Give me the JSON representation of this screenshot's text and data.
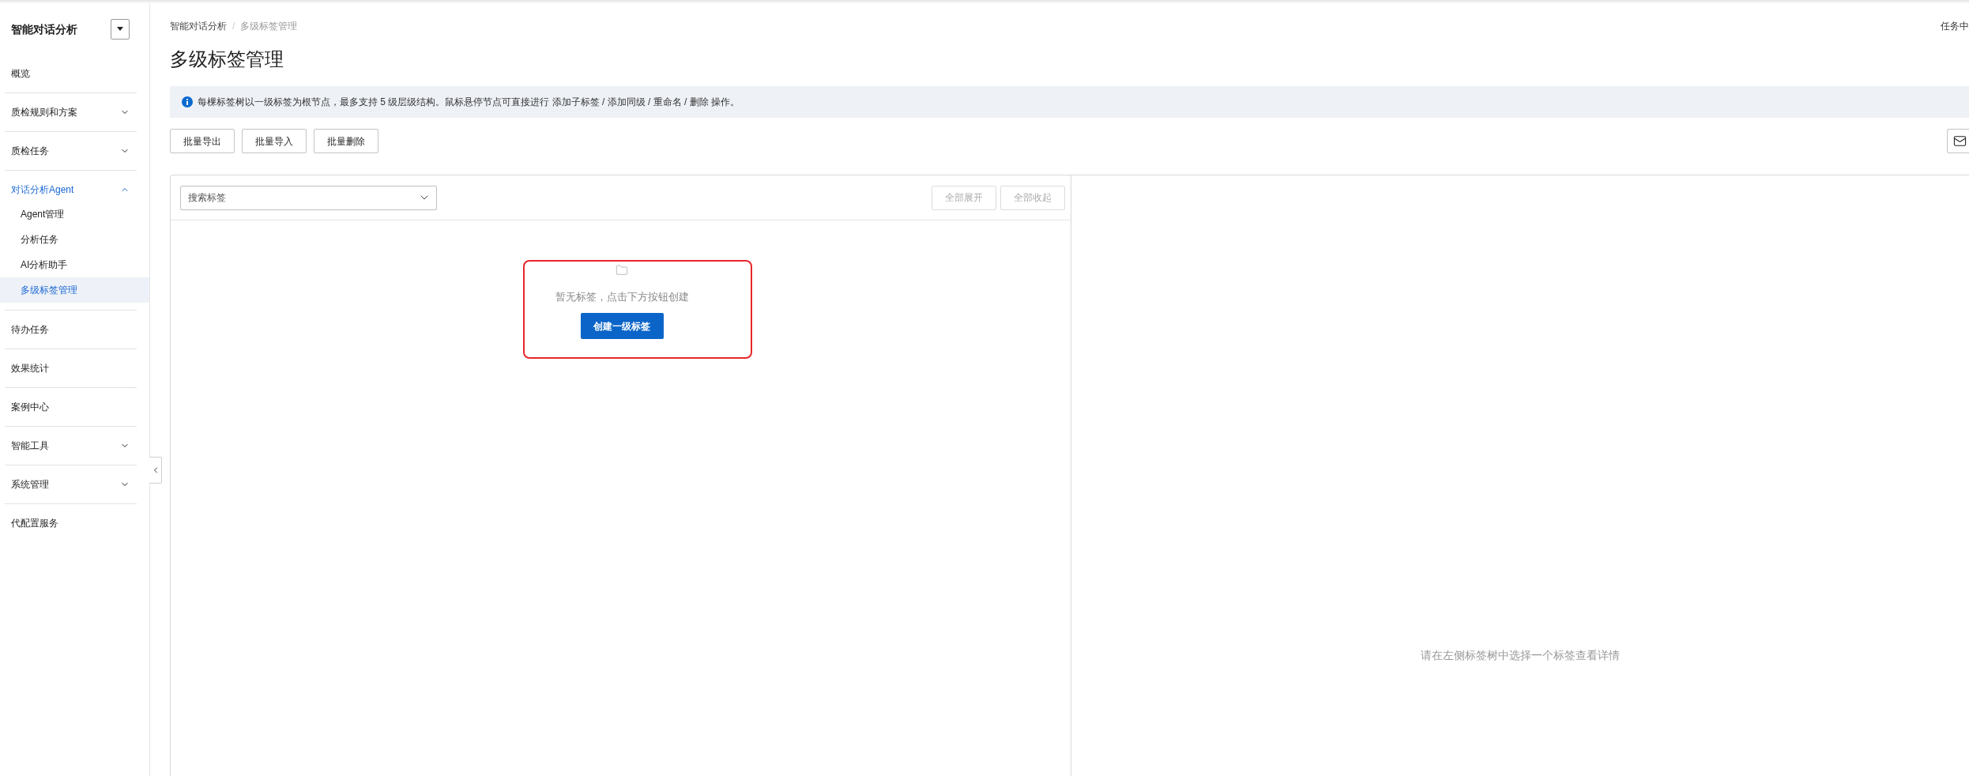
{
  "sidebar": {
    "title": "智能对话分析",
    "items": [
      {
        "label": "概览",
        "kind": "link",
        "selected": false
      },
      {
        "label": "质检规则和方案",
        "kind": "group",
        "selected": false,
        "expanded": false
      },
      {
        "label": "质检任务",
        "kind": "group",
        "selected": false,
        "expanded": false
      },
      {
        "label": "对话分析Agent",
        "kind": "group",
        "selected": true,
        "expanded": true,
        "children": [
          {
            "label": "Agent管理",
            "selected": false
          },
          {
            "label": "分析任务",
            "selected": false
          },
          {
            "label": "AI分析助手",
            "selected": false
          },
          {
            "label": "多级标签管理",
            "selected": true
          }
        ]
      },
      {
        "label": "待办任务",
        "kind": "link",
        "selected": false
      },
      {
        "label": "效果统计",
        "kind": "link",
        "selected": false
      },
      {
        "label": "案例中心",
        "kind": "link",
        "selected": false
      },
      {
        "label": "智能工具",
        "kind": "group",
        "selected": false,
        "expanded": false
      },
      {
        "label": "系统管理",
        "kind": "group",
        "selected": false,
        "expanded": false
      },
      {
        "label": "代配置服务",
        "kind": "link",
        "selected": false
      }
    ]
  },
  "breadcrumb": {
    "items": [
      "智能对话分析",
      "多级标签管理"
    ],
    "separator": "/"
  },
  "header_link": "任务中",
  "page_title": "多级标签管理",
  "notice": "每棵标签树以一级标签为根节点，最多支持 5 级层级结构。鼠标悬停节点可直接进行 添加子标签 / 添加同级 / 重命名 / 删除 操作。",
  "toolbar": {
    "buttons": [
      {
        "label": "批量导出",
        "disabled": false
      },
      {
        "label": "批量导入",
        "disabled": false
      },
      {
        "label": "批量删除",
        "disabled": false
      }
    ]
  },
  "tag_tree": {
    "search": {
      "placeholder": "搜索标签"
    },
    "buttons": [
      {
        "label": "全部展开",
        "disabled": true
      },
      {
        "label": "全部收起",
        "disabled": true
      }
    ],
    "empty_state": {
      "message": "暂无标签，点击下方按钮创建",
      "button": "创建一级标签",
      "highlighted": true
    }
  },
  "detail_panel": {
    "message": "请在左侧标签树中选择一个标签查看详情"
  }
}
